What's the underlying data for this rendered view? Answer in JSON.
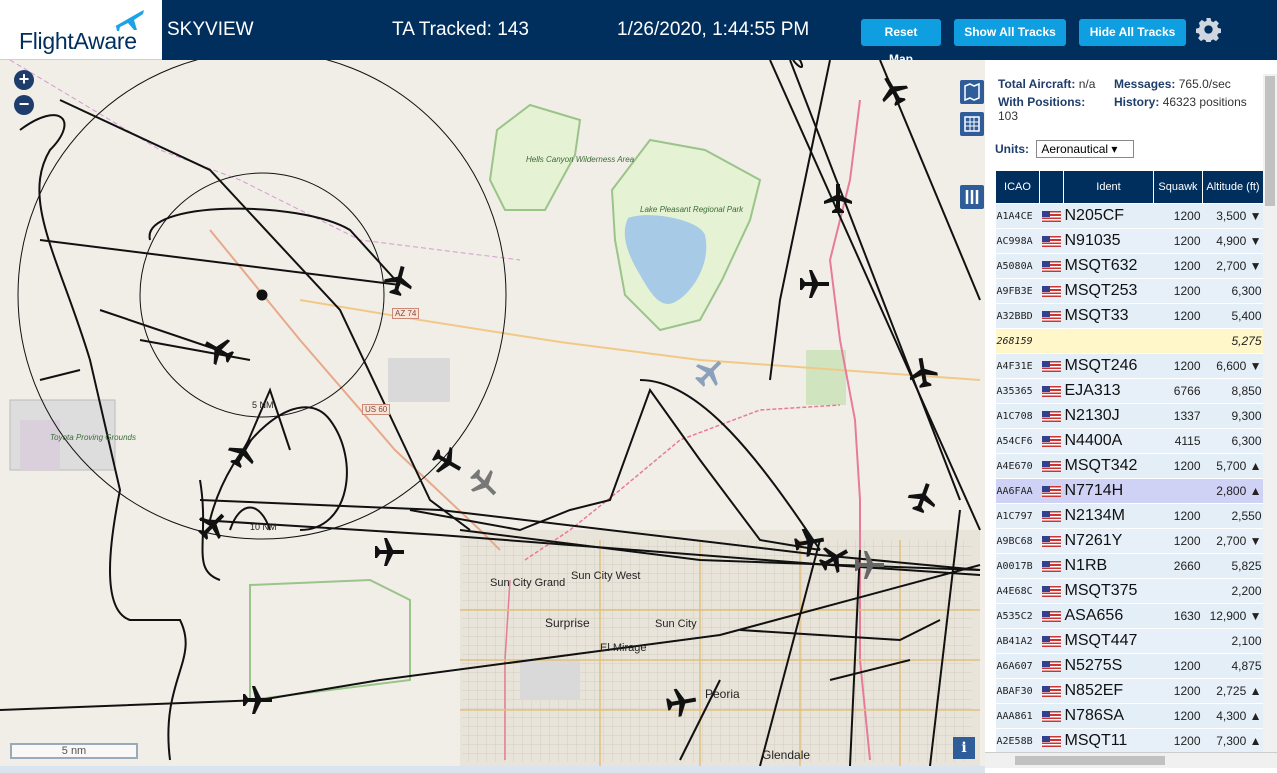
{
  "header": {
    "logo_text": "FlightAware",
    "site_name": "SKYVIEW",
    "ta_tracked": "TA Tracked: 143",
    "clock": "1/26/2020, 1:44:55 PM",
    "buttons": {
      "reset": "Reset Map",
      "show_all": "Show All Tracks",
      "hide_all": "Hide All Tracks"
    },
    "settings_icon": "gear-icon"
  },
  "map": {
    "zoom_in": "+",
    "zoom_out": "−",
    "scale": "5 nm",
    "info": "i",
    "range_rings": [
      "5 NM",
      "10 NM"
    ],
    "labels": {
      "hells_canyon": "Hells Canyon Wilderness Area",
      "lake_pleasant": "Lake Pleasant Regional Park",
      "toyota": "Toyota Proving Grounds",
      "sun_city_grand": "Sun City Grand",
      "sun_city_west": "Sun City West",
      "surprise": "Surprise",
      "sun_city": "Sun City",
      "el_mirage": "El Mirage",
      "peoria": "Peoria",
      "glendale": "Glendale",
      "az74": "AZ 74",
      "us60": "US 60"
    }
  },
  "stats": {
    "total_label": "Total Aircraft:",
    "total_value": "n/a",
    "messages_label": "Messages:",
    "messages_value": "765.0/sec",
    "positions_label": "With Positions:",
    "positions_value": "103",
    "history_label": "History:",
    "history_value": "46323 positions",
    "units_label": "Units:",
    "units_value": "Aeronautical ▾"
  },
  "table": {
    "headers": [
      "ICAO",
      "",
      "Ident",
      "Squawk",
      "Altitude (ft)"
    ],
    "rows": [
      {
        "icao": "A1A4CE",
        "flag": true,
        "ident": "N205CF",
        "squawk": "1200",
        "alt": "3,500 ▼"
      },
      {
        "icao": "AC998A",
        "flag": true,
        "ident": "N91035",
        "squawk": "1200",
        "alt": "4,900 ▼"
      },
      {
        "icao": "A5080A",
        "flag": true,
        "ident": "MSQT632",
        "squawk": "1200",
        "alt": "2,700 ▼"
      },
      {
        "icao": "A9FB3E",
        "flag": true,
        "ident": "MSQT253",
        "squawk": "1200",
        "alt": "6,300"
      },
      {
        "icao": "A32BBD",
        "flag": true,
        "ident": "MSQT33",
        "squawk": "1200",
        "alt": "5,400"
      },
      {
        "icao": "268159",
        "flag": false,
        "ident": "",
        "squawk": "",
        "alt": "5,275",
        "state": "mlat"
      },
      {
        "icao": "A4F31E",
        "flag": true,
        "ident": "MSQT246",
        "squawk": "1200",
        "alt": "6,600 ▼"
      },
      {
        "icao": "A35365",
        "flag": true,
        "ident": "EJA313",
        "squawk": "6766",
        "alt": "8,850"
      },
      {
        "icao": "A1C708",
        "flag": true,
        "ident": "N2130J",
        "squawk": "1337",
        "alt": "9,300"
      },
      {
        "icao": "A54CF6",
        "flag": true,
        "ident": "N4400A",
        "squawk": "4115",
        "alt": "6,300"
      },
      {
        "icao": "A4E670",
        "flag": true,
        "ident": "MSQT342",
        "squawk": "1200",
        "alt": "5,700 ▲"
      },
      {
        "icao": "AA6FAA",
        "flag": true,
        "ident": "N7714H",
        "squawk": "",
        "alt": "2,800 ▲",
        "state": "selected"
      },
      {
        "icao": "A1C797",
        "flag": true,
        "ident": "N2134M",
        "squawk": "1200",
        "alt": "2,550"
      },
      {
        "icao": "A9BC68",
        "flag": true,
        "ident": "N7261Y",
        "squawk": "1200",
        "alt": "2,700 ▼"
      },
      {
        "icao": "A0017B",
        "flag": true,
        "ident": "N1RB",
        "squawk": "2660",
        "alt": "5,825"
      },
      {
        "icao": "A4E68C",
        "flag": true,
        "ident": "MSQT375",
        "squawk": "",
        "alt": "2,200"
      },
      {
        "icao": "A535C2",
        "flag": true,
        "ident": "ASA656",
        "squawk": "1630",
        "alt": "12,900 ▼"
      },
      {
        "icao": "AB41A2",
        "flag": true,
        "ident": "MSQT447",
        "squawk": "",
        "alt": "2,100"
      },
      {
        "icao": "A6A607",
        "flag": true,
        "ident": "N5275S",
        "squawk": "1200",
        "alt": "4,875"
      },
      {
        "icao": "ABAF30",
        "flag": true,
        "ident": "N852EF",
        "squawk": "1200",
        "alt": "2,725 ▲"
      },
      {
        "icao": "AAA861",
        "flag": true,
        "ident": "N786SA",
        "squawk": "1200",
        "alt": "4,300 ▲"
      },
      {
        "icao": "A2E58B",
        "flag": true,
        "ident": "MSQT11",
        "squawk": "1200",
        "alt": "7,300 ▲"
      }
    ]
  }
}
